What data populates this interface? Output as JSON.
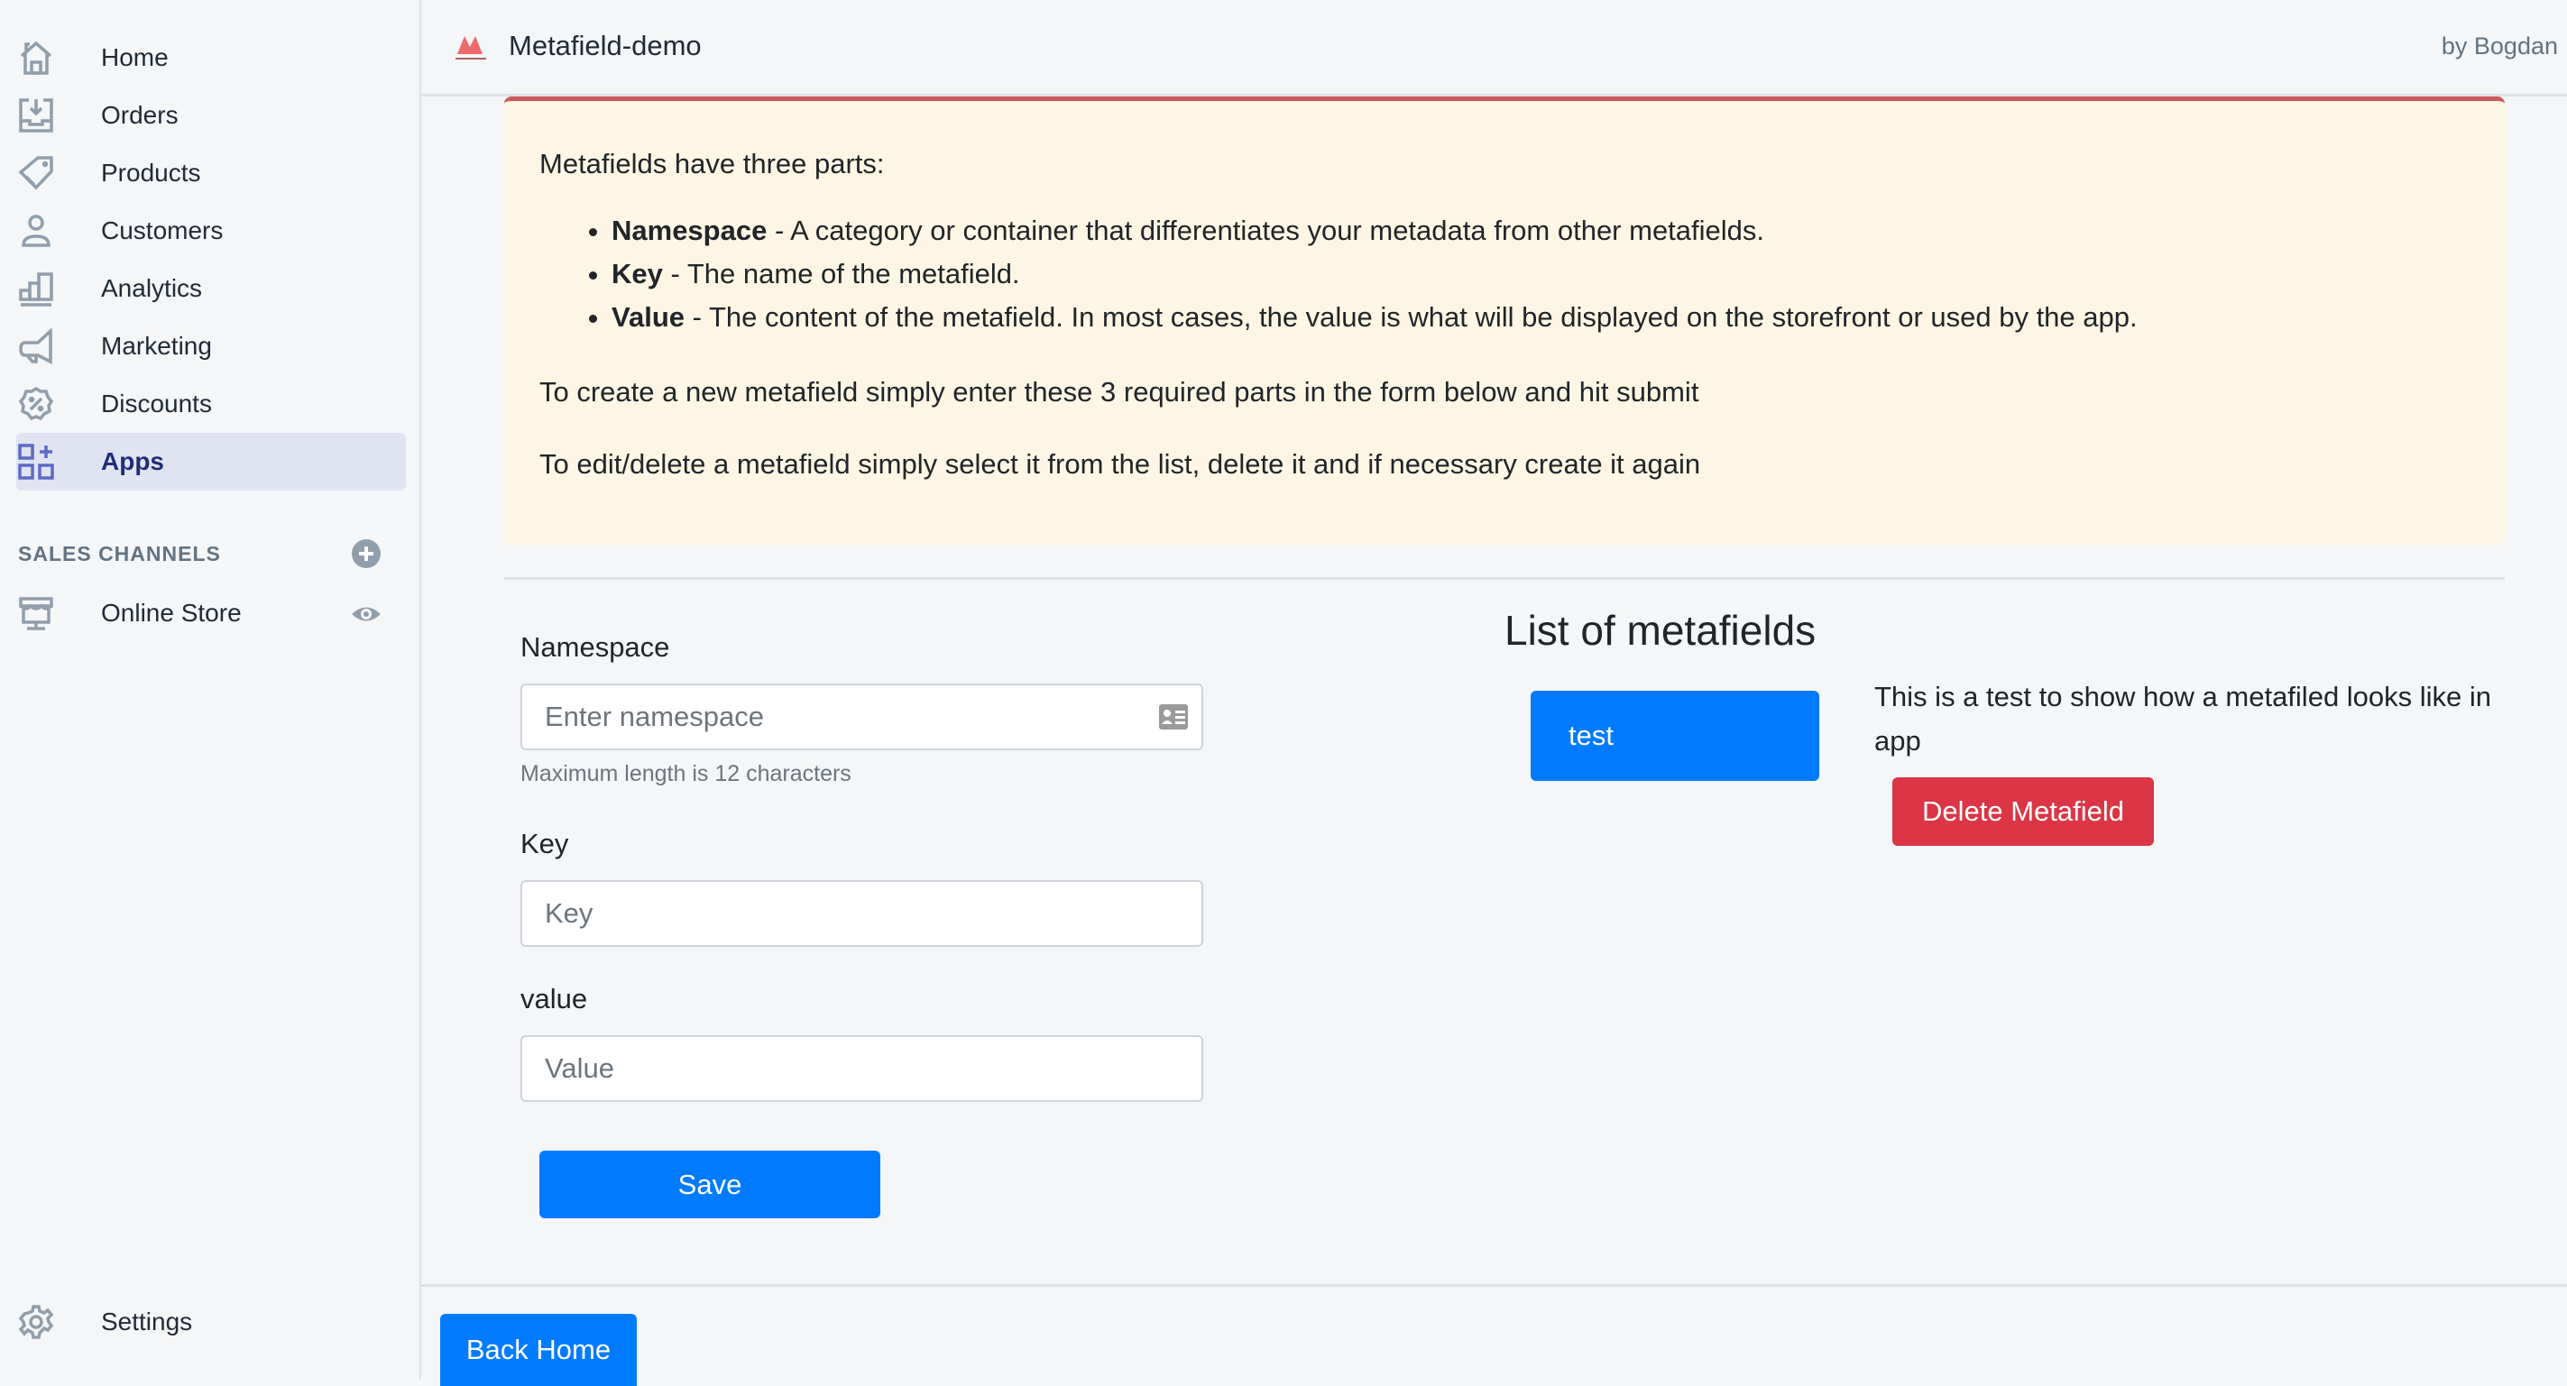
{
  "sidebar": {
    "items": [
      {
        "label": "Home",
        "icon": "home-icon"
      },
      {
        "label": "Orders",
        "icon": "orders-icon"
      },
      {
        "label": "Products",
        "icon": "tag-icon"
      },
      {
        "label": "Customers",
        "icon": "person-icon"
      },
      {
        "label": "Analytics",
        "icon": "bar-chart-icon"
      },
      {
        "label": "Marketing",
        "icon": "megaphone-icon"
      },
      {
        "label": "Discounts",
        "icon": "discount-badge-icon"
      },
      {
        "label": "Apps",
        "icon": "apps-icon",
        "active": true
      }
    ],
    "sales_channels_title": "SALES CHANNELS",
    "channels": [
      {
        "label": "Online Store",
        "icon": "store-icon"
      }
    ],
    "settings_label": "Settings"
  },
  "header": {
    "app_title": "Metafield-demo",
    "byline": "by Bogdan"
  },
  "notice": {
    "intro": "Metafields have three parts:",
    "parts": [
      {
        "term": "Namespace",
        "desc": " - A category or container that differentiates your metadata from other metafields."
      },
      {
        "term": "Key",
        "desc": " - The name of the metafield."
      },
      {
        "term": "Value",
        "desc": " - The content of the metafield. In most cases, the value is what will be displayed on the storefront or used by the app."
      }
    ],
    "create_text": "To create a new metafield simply enter these 3 required parts in the form below and hit submit",
    "edit_text": "To edit/delete a metafield simply select it from the list, delete it and if necessary create it again"
  },
  "form": {
    "namespace_label": "Namespace",
    "namespace_placeholder": "Enter namespace",
    "namespace_value": "",
    "namespace_help": "Maximum length is 12 characters",
    "key_label": "Key",
    "key_placeholder": "Key",
    "key_value": "",
    "value_label": "value",
    "value_placeholder": "Value",
    "value_value": "",
    "save_label": "Save"
  },
  "list": {
    "title": "List of metafields",
    "items": [
      {
        "key": "test",
        "value": "This is a test to show how a metafiled looks like in app"
      }
    ],
    "delete_label": "Delete Metafield"
  },
  "footer": {
    "back_home_label": "Back Home"
  },
  "colors": {
    "primary": "#007bff",
    "danger": "#dc3545",
    "notice_bg": "#fdf6e4",
    "notice_border": "#c95b5b",
    "active_nav_bg": "#e0e4f2",
    "active_nav_text": "#202e78"
  }
}
